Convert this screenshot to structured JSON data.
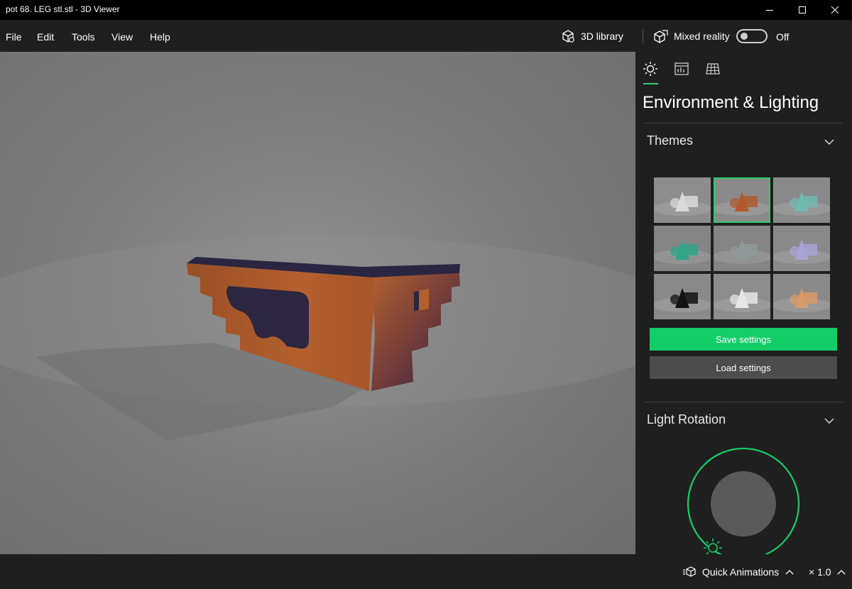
{
  "window": {
    "title": "pot 68. LEG stl.stl - 3D Viewer"
  },
  "menu": {
    "items": [
      "File",
      "Edit",
      "Tools",
      "View",
      "Help"
    ]
  },
  "toolbar": {
    "library_label": "3D library",
    "mixed_reality_label": "Mixed reality",
    "mixed_reality_state": "Off",
    "mixed_reality_on": false
  },
  "panel": {
    "tabs": [
      {
        "icon": "sun-icon",
        "active": true
      },
      {
        "icon": "stats-icon",
        "active": false
      },
      {
        "icon": "grid-icon",
        "active": false
      }
    ],
    "title": "Environment & Lighting",
    "themes": {
      "heading": "Themes",
      "selected_index": 1,
      "swatches": [
        {
          "bg": "#8d8d8d",
          "shape": "#d9d9d9"
        },
        {
          "bg": "#8a8a8a",
          "shape": "#b05a2e"
        },
        {
          "bg": "#8a8a8a",
          "shape": "#6fbab0"
        },
        {
          "bg": "#858585",
          "shape": "#2fa58a"
        },
        {
          "bg": "#858585",
          "shape": "#8f9a98"
        },
        {
          "bg": "#8a8a8a",
          "shape": "#a9a2d6"
        },
        {
          "bg": "#8a8a8a",
          "shape": "#111111"
        },
        {
          "bg": "#8d8d8d",
          "shape": "#e6e6e6"
        },
        {
          "bg": "#8a8a8a",
          "shape": "#d79a6a"
        }
      ],
      "save_label": "Save settings",
      "load_label": "Load settings"
    },
    "light_rotation": {
      "heading": "Light Rotation"
    }
  },
  "status": {
    "quick_animations_label": "Quick Animations",
    "zoom_label": "× 1.0"
  },
  "colors": {
    "accent": "#13ce66",
    "object": "#b4602e",
    "object_shadow": "#2a2540"
  }
}
